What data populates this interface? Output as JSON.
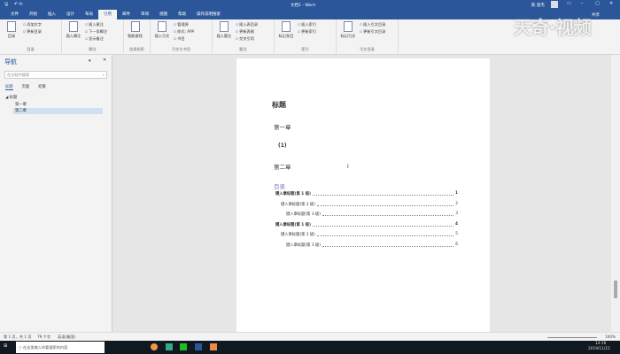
{
  "title": {
    "doc": "文档1 - Word",
    "user": "陈 俊杰",
    "share": "共享"
  },
  "tabs": [
    "文件",
    "开始",
    "插入",
    "设计",
    "布局",
    "引用",
    "邮件",
    "审阅",
    "视图",
    "帮助",
    "操作说明搜索"
  ],
  "active_tab": 5,
  "ribbon": {
    "groups": [
      {
        "label": "目录",
        "big": "目录",
        "small": [
          "添加文字",
          "更新目录"
        ]
      },
      {
        "label": "脚注",
        "big": "插入脚注",
        "small": [
          "插入尾注",
          "下一条脚注",
          "显示备注"
        ]
      },
      {
        "label": "信息检索",
        "big": "智能查找",
        "small": []
      },
      {
        "label": "引文与书目",
        "big": "插入引文",
        "small": [
          "管理源",
          "样式: APA",
          "书目"
        ]
      },
      {
        "label": "题注",
        "big": "插入题注",
        "small": [
          "插入表目录",
          "更新表格",
          "交叉引用"
        ]
      },
      {
        "label": "索引",
        "big": "标记条目",
        "small": [
          "插入索引",
          "更新索引"
        ]
      },
      {
        "label": "引文目录",
        "big": "标记引文",
        "small": [
          "插入引文目录",
          "更新引文目录"
        ]
      }
    ]
  },
  "watermark": "天奇·视频",
  "nav": {
    "title": "导航",
    "search_placeholder": "在文档中搜索",
    "tabs": [
      "标题",
      "页面",
      "结果"
    ],
    "tree": [
      "标题",
      "第一章",
      "第二章"
    ]
  },
  "doc": {
    "heading": "标题",
    "ch1": "第一章",
    "item": "(1)",
    "ch2": "第二章",
    "toc_title": "目录",
    "toc": [
      {
        "text": "键入章标题(第 1 级)",
        "page": "1",
        "level": 1
      },
      {
        "text": "键入章标题(第 2 级)",
        "page": "2",
        "level": 2
      },
      {
        "text": "键入章标题(第 3 级)",
        "page": "3",
        "level": 3
      },
      {
        "text": "键入章标题(第 1 级)",
        "page": "4",
        "level": 1
      },
      {
        "text": "键入章标题(第 2 级)",
        "page": "5",
        "level": 2
      },
      {
        "text": "键入章标题(第 3 级)",
        "page": "6",
        "level": 3
      }
    ]
  },
  "status": {
    "page": "第 1 页，共 1 页",
    "words": "79 个字",
    "lang": "英语(美国)",
    "zoom": "100%"
  },
  "taskbar": {
    "search": "在这里输入你要搜索的内容",
    "time": "14:16",
    "date": "2019/11/15"
  }
}
